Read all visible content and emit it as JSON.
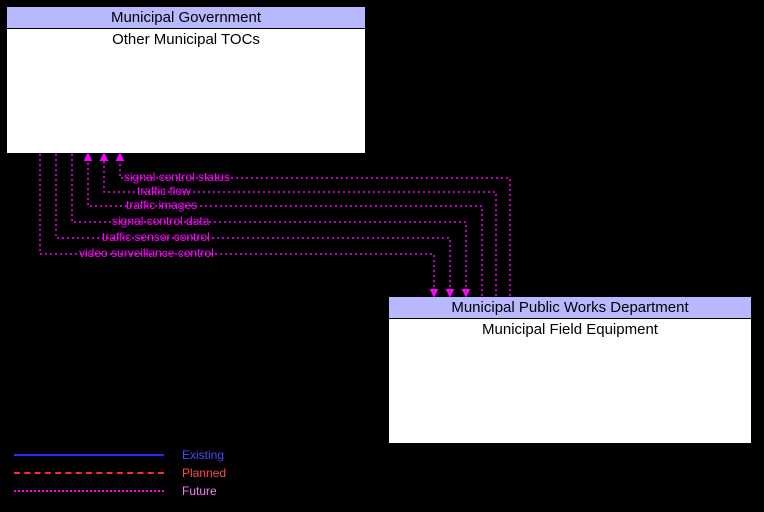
{
  "boxes": {
    "topLeft": {
      "header": "Municipal Government",
      "body": "Other Municipal TOCs"
    },
    "bottomRight": {
      "header": "Municipal Public Works Department",
      "body": "Municipal Field Equipment"
    }
  },
  "flows": {
    "toBottom": [
      "signal control data",
      "traffic sensor control",
      "video surveillance control"
    ],
    "toTop": [
      "signal control status",
      "traffic flow",
      "traffic images"
    ]
  },
  "legend": {
    "existing": "Existing",
    "planned": "Planned",
    "future": "Future"
  }
}
